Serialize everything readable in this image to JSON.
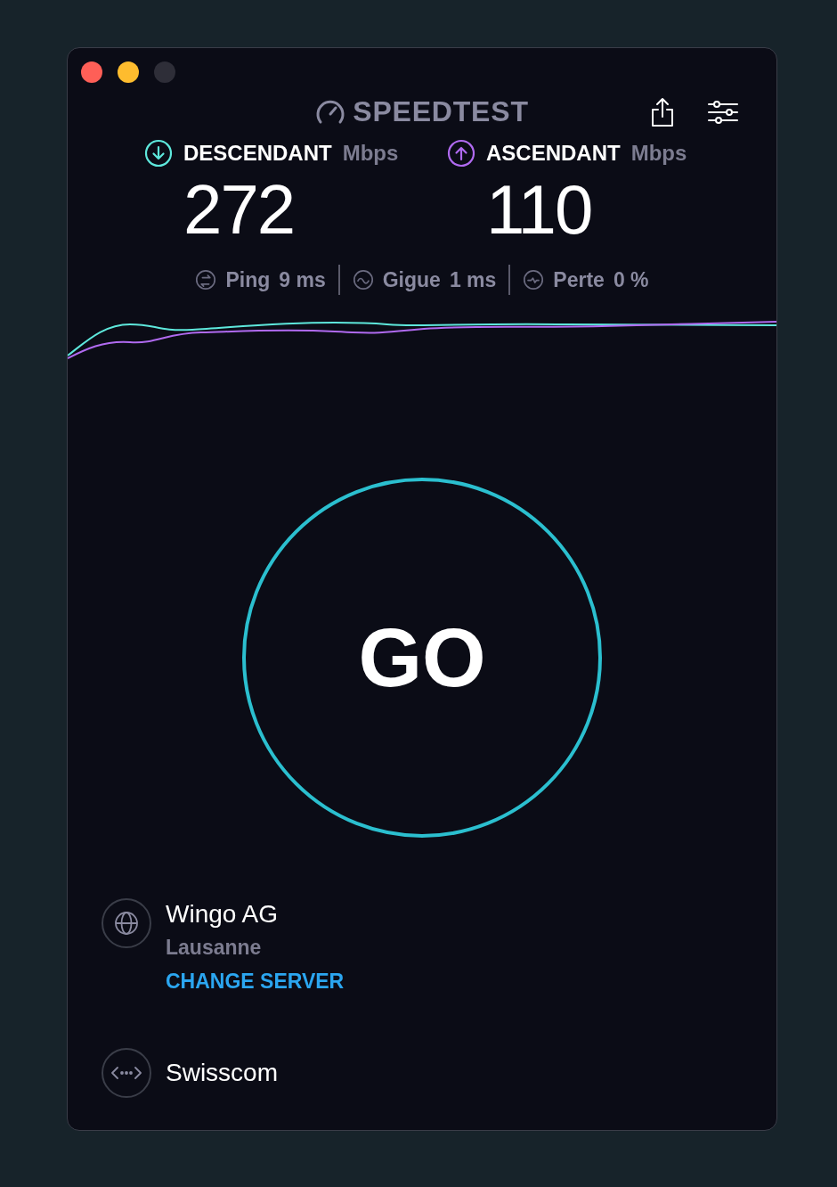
{
  "window": {
    "controls": [
      {
        "color": "#fe5f57"
      },
      {
        "color": "#febc2e"
      },
      {
        "color": "#2e2e38"
      }
    ]
  },
  "header": {
    "logo": "SPEEDTEST"
  },
  "metrics": [
    {
      "kind": "download",
      "label": "DESCENDANT",
      "unit": "Mbps",
      "value": "272"
    },
    {
      "kind": "upload",
      "label": "ASCENDANT",
      "unit": "Mbps",
      "value": "110"
    }
  ],
  "stats": [
    {
      "kind": "ping",
      "label": "Ping",
      "value": "9 ms"
    },
    {
      "kind": "jitter",
      "label": "Gigue",
      "value": "1 ms"
    },
    {
      "kind": "loss",
      "label": "Perte",
      "value": "0 %"
    }
  ],
  "go_button": {
    "label": "GO"
  },
  "server": {
    "name": "Wingo AG",
    "location": "Lausanne",
    "action": "CHANGE SERVER"
  },
  "provider": {
    "name": "Swisscom"
  }
}
